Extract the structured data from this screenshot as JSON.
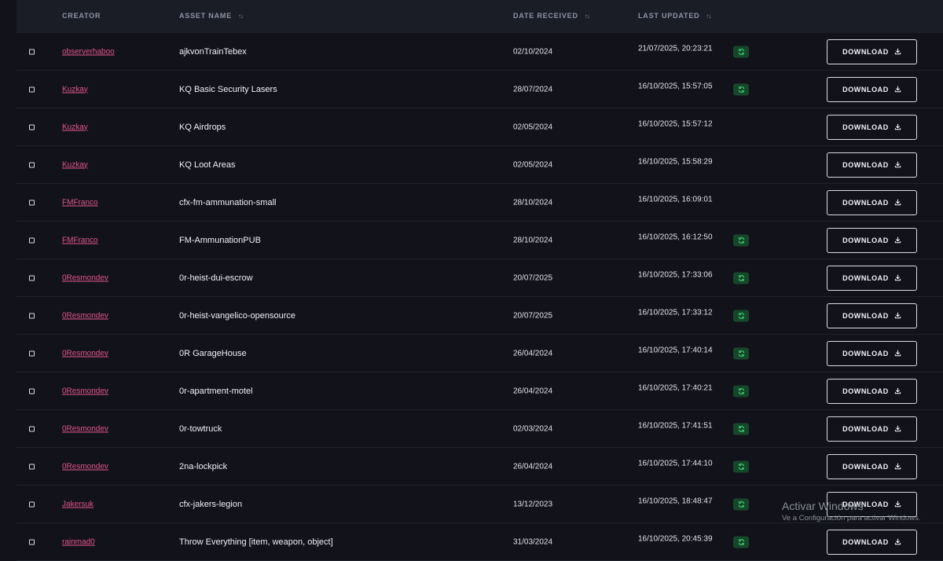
{
  "table": {
    "headers": {
      "creator": "CREATOR",
      "asset_name": "ASSET NAME",
      "date_received": "DATE RECEIVED",
      "last_updated": "LAST UPDATED"
    },
    "sort_icon": "sort-arrows-icon",
    "download_label": "DOWNLOAD",
    "rows": [
      {
        "creator": "observerhaboo",
        "asset": "ajkvonTrainTebex",
        "received": "02/10/2024",
        "updated": "21/07/2025, 20:23:21",
        "refresh": true
      },
      {
        "creator": "Kuzkay",
        "asset": "KQ Basic Security Lasers",
        "received": "28/07/2024",
        "updated": "16/10/2025, 15:57:05",
        "refresh": true
      },
      {
        "creator": "Kuzkay",
        "asset": "KQ Airdrops",
        "received": "02/05/2024",
        "updated": "16/10/2025, 15:57:12",
        "refresh": false
      },
      {
        "creator": "Kuzkay",
        "asset": "KQ Loot Areas",
        "received": "02/05/2024",
        "updated": "16/10/2025, 15:58:29",
        "refresh": false
      },
      {
        "creator": "FMFranco",
        "asset": "cfx-fm-ammunation-small",
        "received": "28/10/2024",
        "updated": "16/10/2025, 16:09:01",
        "refresh": false
      },
      {
        "creator": "FMFranco",
        "asset": "FM-AmmunationPUB",
        "received": "28/10/2024",
        "updated": "16/10/2025, 16:12:50",
        "refresh": true
      },
      {
        "creator": "0Resmondev",
        "asset": "0r-heist-dui-escrow",
        "received": "20/07/2025",
        "updated": "16/10/2025, 17:33:06",
        "refresh": true
      },
      {
        "creator": "0Resmondev",
        "asset": "0r-heist-vangelico-opensource",
        "received": "20/07/2025",
        "updated": "16/10/2025, 17:33:12",
        "refresh": true
      },
      {
        "creator": "0Resmondev",
        "asset": "0R GarageHouse",
        "received": "26/04/2024",
        "updated": "16/10/2025, 17:40:14",
        "refresh": true
      },
      {
        "creator": "0Resmondev",
        "asset": "0r-apartment-motel",
        "received": "26/04/2024",
        "updated": "16/10/2025, 17:40:21",
        "refresh": true
      },
      {
        "creator": "0Resmondev",
        "asset": "0r-towtruck",
        "received": "02/03/2024",
        "updated": "16/10/2025, 17:41:51",
        "refresh": true
      },
      {
        "creator": "0Resmondev",
        "asset": "2na-lockpick",
        "received": "26/04/2024",
        "updated": "16/10/2025, 17:44:10",
        "refresh": true
      },
      {
        "creator": "Jakersuk",
        "asset": "cfx-jakers-legion",
        "received": "13/12/2023",
        "updated": "16/10/2025, 18:48:47",
        "refresh": true
      },
      {
        "creator": "rainmad0",
        "asset": "Throw Everything [item, weapon, object]",
        "received": "31/03/2024",
        "updated": "16/10/2025, 20:45:39",
        "refresh": true
      }
    ]
  },
  "watermark": {
    "title": "Activar Windows",
    "subtitle": "Ve a Configuración para activar Windows."
  },
  "colors": {
    "background": "#12131a",
    "header": "#1b1d26",
    "creator_link": "#e4548f",
    "refresh_bg": "#17472b",
    "refresh_icon": "#3ddc74"
  }
}
